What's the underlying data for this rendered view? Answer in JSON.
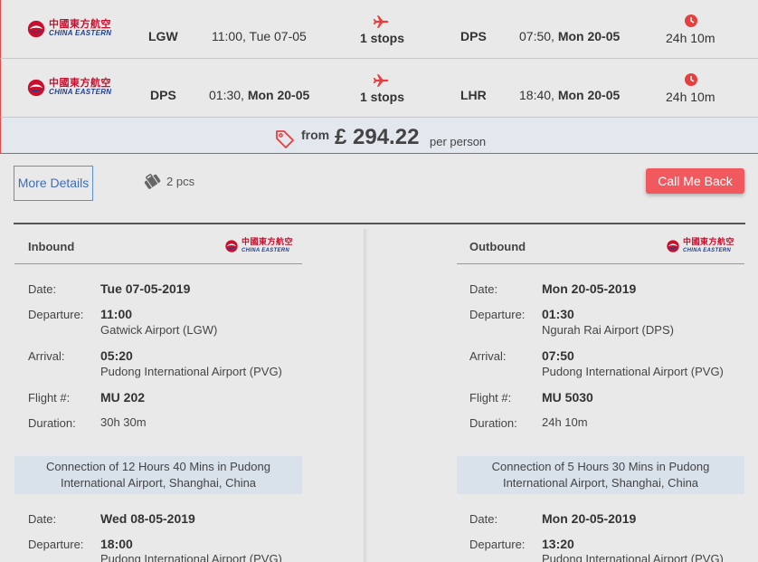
{
  "flights": [
    {
      "airline_cn": "中國東方航空",
      "airline_en": "CHINA EASTERN",
      "from_code": "LGW",
      "dep_time": "11:00, ",
      "dep_date": "Tue 07-05",
      "stops": "1 stops",
      "to_code": "DPS",
      "arr_time": "07:50, ",
      "arr_date": "Mon 20-05",
      "duration": "24h 10m"
    },
    {
      "airline_cn": "中國東方航空",
      "airline_en": "CHINA EASTERN",
      "from_code": "DPS",
      "dep_time": "01:30, ",
      "dep_date": "Mon 20-05",
      "stops": "1 stops",
      "to_code": "LHR",
      "arr_time": "18:40, ",
      "arr_date": "Mon 20-05",
      "duration": "24h 10m"
    }
  ],
  "price": {
    "from": "from",
    "amount": "£ 294.22",
    "per": "per person"
  },
  "actions": {
    "more_details": "More Details",
    "baggage": "2 pcs",
    "call_back": "Call Me Back"
  },
  "colors": {
    "accent_red": "#f05a5f",
    "link_blue": "#3a6ec0",
    "price_bg": "#e3e8ef"
  },
  "inbound": {
    "title": "Inbound",
    "labels": {
      "date": "Date:",
      "departure": "Departure:",
      "arrival": "Arrival:",
      "flight": "Flight #:",
      "duration": "Duration:"
    },
    "leg1": {
      "date": "Tue 07-05-2019",
      "dep_time": "11:00",
      "dep_airport": "Gatwick Airport (LGW)",
      "arr_time": "05:20",
      "arr_airport": "Pudong International Airport (PVG)",
      "flight": "MU 202",
      "duration": "30h 30m"
    },
    "connection_l1": "Connection of 12 Hours 40 Mins in Pudong",
    "connection_l2": "International Airport, Shanghai, China",
    "leg2": {
      "date": "Wed 08-05-2019",
      "dep_time": "18:00",
      "dep_airport": "Pudong International Airport (PVG)"
    }
  },
  "outbound": {
    "title": "Outbound",
    "labels": {
      "date": "Date:",
      "departure": "Departure:",
      "arrival": "Arrival:",
      "flight": "Flight #:",
      "duration": "Duration:"
    },
    "leg1": {
      "date": "Mon 20-05-2019",
      "dep_time": "01:30",
      "dep_airport": "Ngurah Rai Airport (DPS)",
      "arr_time": "07:50",
      "arr_airport": "Pudong International Airport (PVG)",
      "flight": "MU 5030",
      "duration": "24h 10m"
    },
    "connection_l1": "Connection of 5 Hours 30 Mins in Pudong",
    "connection_l2": "International Airport, Shanghai, China",
    "leg2": {
      "date": "Mon 20-05-2019",
      "dep_time": "13:20",
      "dep_airport": "Pudong International Airport (PVG)"
    }
  }
}
